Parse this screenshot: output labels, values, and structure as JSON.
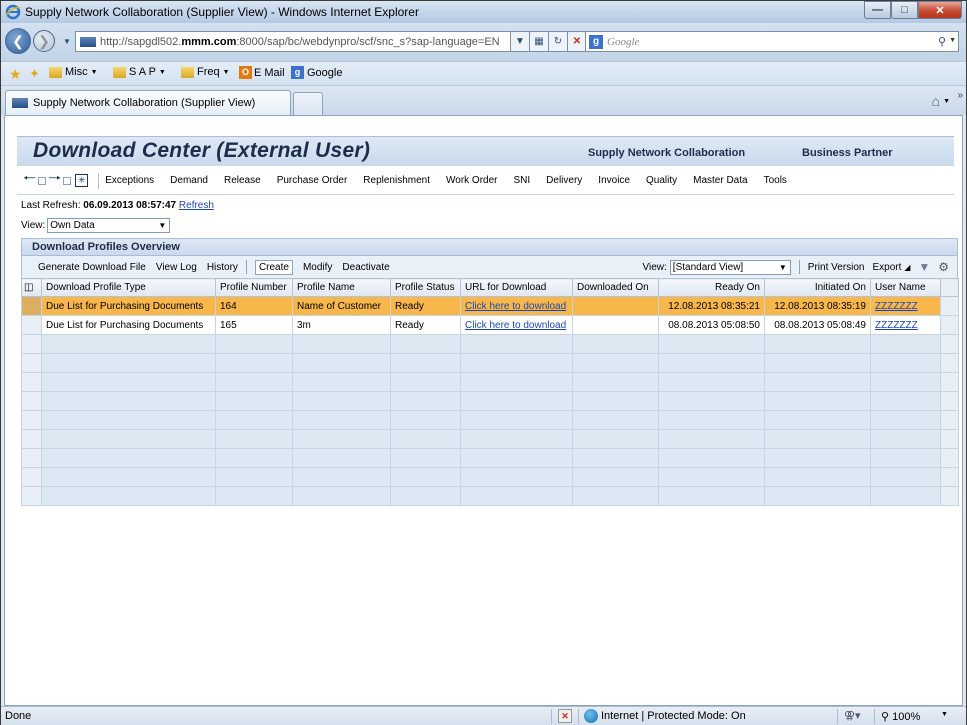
{
  "browser": {
    "window_title": "Supply Network Collaboration (Supplier View) - Windows Internet Explorer",
    "address_prefix": "http://sapgdl502.",
    "address_domain": "mmm.com",
    "address_suffix": ":8000/sap/bc/webdynpro/scf/snc_s?sap-language=EN",
    "search_placeholder": "Google",
    "favorites": [
      "Misc",
      "S A P",
      "Freq",
      "E Mail",
      "Google"
    ],
    "tab_title": "Supply Network Collaboration (Supplier View)",
    "status_text": "Done",
    "zone_text": "Internet | Protected Mode: On",
    "zoom": "100%"
  },
  "portal": {
    "title": "Download Center (External User)",
    "header_links": [
      "Supply Network Collaboration",
      "Business Partner"
    ],
    "nav_items": [
      "Exceptions",
      "Demand",
      "Release",
      "Purchase Order",
      "Replenishment",
      "Work Order",
      "SNI",
      "Delivery",
      "Invoice",
      "Quality",
      "Master Data",
      "Tools"
    ]
  },
  "page": {
    "last_refresh_label": "Last Refresh:",
    "last_refresh_value": "06.09.2013 08:57:47",
    "refresh_link": "Refresh",
    "view_label": "View:",
    "view_value": "Own Data"
  },
  "panel": {
    "title": "Download Profiles Overview",
    "toolbar": {
      "generate": "Generate Download File",
      "view_log": "View Log",
      "history": "History",
      "create": "Create",
      "modify": "Modify",
      "deactivate": "Deactivate",
      "view_label": "View:",
      "view_value": "[Standard View]",
      "print": "Print Version",
      "export": "Export"
    },
    "columns": [
      "Download Profile Type",
      "Profile Number",
      "Profile Name",
      "Profile Status",
      "URL for Download",
      "Downloaded On",
      "Ready On",
      "Initiated On",
      "User Name"
    ],
    "rows": [
      {
        "type": "Due List for Purchasing Documents",
        "number": "164",
        "name": "Name of Customer",
        "status": "Ready",
        "url": "Click here to download",
        "downloaded": "",
        "ready": "12.08.2013 08:35:21",
        "initiated": "12.08.2013 08:35:19",
        "user": "ZZZZZZZ",
        "selected": true
      },
      {
        "type": "Due List for Purchasing Documents",
        "number": "165",
        "name": "3m",
        "status": "Ready",
        "url": "Click here to download",
        "downloaded": "",
        "ready": "08.08.2013 05:08:50",
        "initiated": "08.08.2013 05:08:49",
        "user": "ZZZZZZZ",
        "selected": false
      }
    ],
    "empty_rows": 9
  },
  "colors": {
    "selected_row": "#f8b74b",
    "link": "#1a46b5",
    "header_text": "#1d2c4b"
  }
}
